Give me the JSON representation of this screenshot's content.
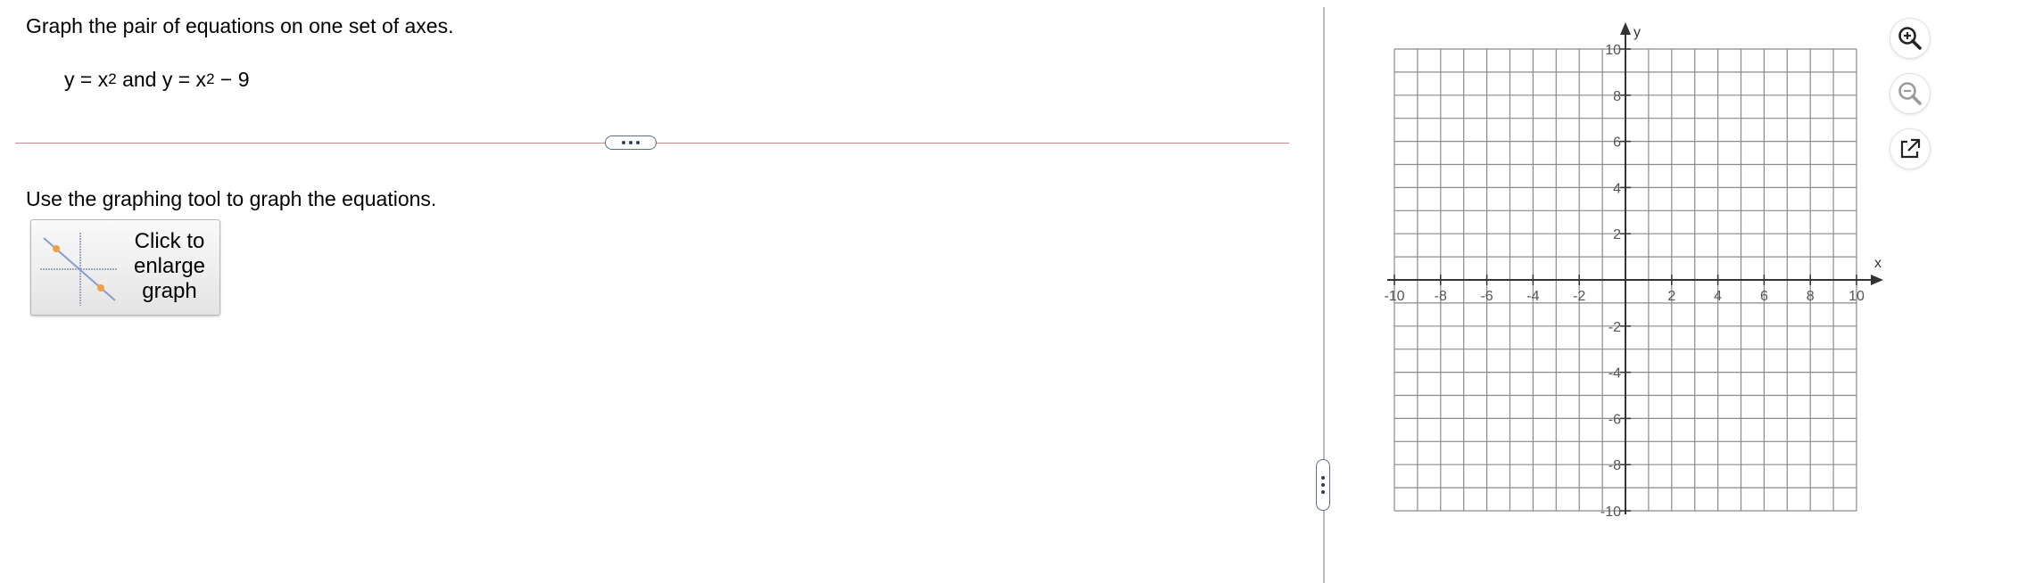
{
  "question": {
    "prompt": "Graph the pair of equations on one set of axes.",
    "eq1_lhs": "y = x",
    "eq1_exp": "2",
    "joiner": " and ",
    "eq2_lhs": "y = x",
    "eq2_exp": "2",
    "eq2_rest": " − 9"
  },
  "instruction": "Use the graphing tool to graph the equations.",
  "enlarge_button": {
    "label": "Click to\nenlarge\ngraph"
  },
  "graph": {
    "x_axis_label": "x",
    "y_axis_label": "y",
    "xlim": [
      -10,
      10
    ],
    "ylim": [
      -10,
      10
    ],
    "grid_step": 1,
    "x_tick_labels": [
      "-10",
      "-8",
      "-6",
      "-4",
      "-2",
      "2",
      "4",
      "6",
      "8",
      "10"
    ],
    "y_tick_labels": [
      "10",
      "8",
      "6",
      "4",
      "2",
      "-2",
      "-4",
      "-6",
      "-8",
      "-10"
    ],
    "grid_color": "#8a8a8a",
    "axis_color": "#333333"
  },
  "tools": {
    "zoom_in": "zoom-in-icon",
    "zoom_out": "zoom-out-icon",
    "popout": "external-link-icon"
  }
}
